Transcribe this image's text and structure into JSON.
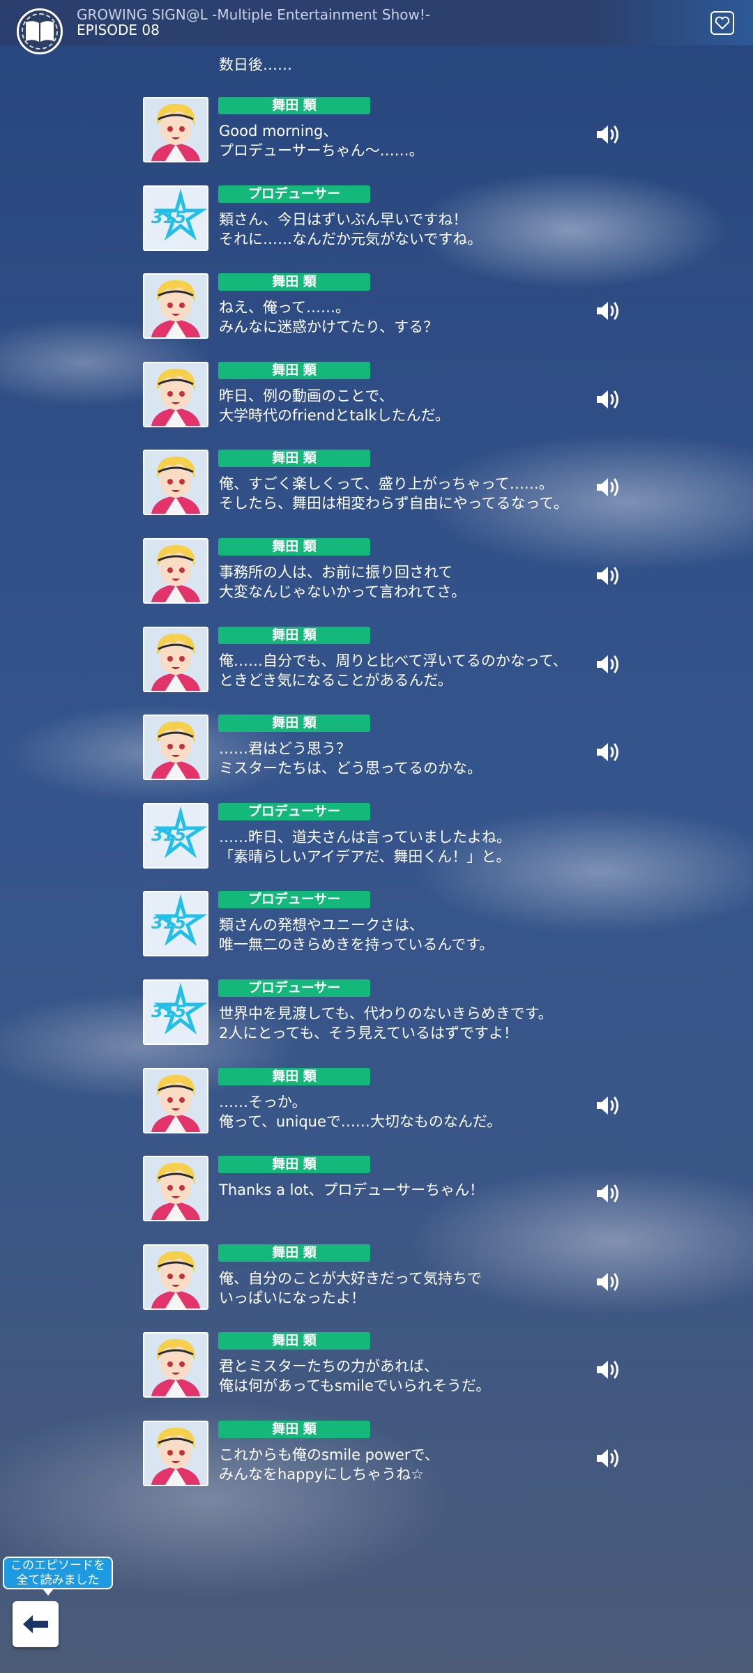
{
  "header": {
    "title": "GROWING SIGN@L -Multiple Entertainment Show!-",
    "episode": "EPISODE 08",
    "menu_icon": "book-icon",
    "favorite_icon": "heart-icon"
  },
  "narration": "数日後……",
  "names": {
    "rui": "舞田 類",
    "producer": "プロデューサー"
  },
  "messages": [
    {
      "speaker": "舞田 類",
      "line1": "Good morning、",
      "line2": "プロデューサーちゃん～……。",
      "voice": true
    },
    {
      "speaker": "プロデューサー",
      "line1": "類さん、今日はずいぶん早いですね！",
      "line2": "それに……なんだか元気がないですね。",
      "voice": false
    },
    {
      "speaker": "舞田 類",
      "line1": "ねえ、俺って……。",
      "line2": "みんなに迷惑かけてたり、する？",
      "voice": true
    },
    {
      "speaker": "舞田 類",
      "line1": "昨日、例の動画のことで、",
      "line2": "大学時代のfriendとtalkしたんだ。",
      "voice": true
    },
    {
      "speaker": "舞田 類",
      "line1": "俺、すごく楽しくって、盛り上がっちゃって……。",
      "line2": "そしたら、舞田は相変わらず自由にやってるなって。",
      "voice": true
    },
    {
      "speaker": "舞田 類",
      "line1": "事務所の人は、お前に振り回されて",
      "line2": "大変なんじゃないかって言われてさ。",
      "voice": true
    },
    {
      "speaker": "舞田 類",
      "line1": "俺……自分でも、周りと比べて浮いてるのかなって、",
      "line2": "ときどき気になることがあるんだ。",
      "voice": true
    },
    {
      "speaker": "舞田 類",
      "line1": "……君はどう思う？",
      "line2": "ミスターたちは、どう思ってるのかな。",
      "voice": true
    },
    {
      "speaker": "プロデューサー",
      "line1": "……昨日、道夫さんは言っていましたよね。",
      "line2": "「素晴らしいアイデアだ、舞田くん！」と。",
      "voice": false
    },
    {
      "speaker": "プロデューサー",
      "line1": "類さんの発想やユニークさは、",
      "line2": "唯一無二のきらめきを持っているんです。",
      "voice": false
    },
    {
      "speaker": "プロデューサー",
      "line1": "世界中を見渡しても、代わりのないきらめきです。",
      "line2": "2人にとっても、そう見えているはずですよ！",
      "voice": false
    },
    {
      "speaker": "舞田 類",
      "line1": "……そっか。",
      "line2": "俺って、uniqueで……大切なものなんだ。",
      "voice": true
    },
    {
      "speaker": "舞田 類",
      "line1": "Thanks a lot、プロデューサーちゃん！",
      "line2": "",
      "voice": true
    },
    {
      "speaker": "舞田 類",
      "line1": "俺、自分のことが大好きだって気持ちで",
      "line2": "いっぱいになったよ！",
      "voice": true
    },
    {
      "speaker": "舞田 類",
      "line1": "君とミスターたちの力があれば、",
      "line2": "俺は何があってもsmileでいられそうだ。",
      "voice": true
    },
    {
      "speaker": "舞田 類",
      "line1": "これからも俺のsmile powerで、",
      "line2": "みんなをhappyにしちゃうね☆",
      "voice": true
    }
  ],
  "footer": {
    "read_badge_line1": "このエピソードを",
    "read_badge_line2": "全て読みました",
    "back_icon": "back-arrow-icon"
  },
  "colors": {
    "nametag": "#13b87a",
    "badge": "#1e9ae0",
    "header": "#2a3f6d"
  }
}
